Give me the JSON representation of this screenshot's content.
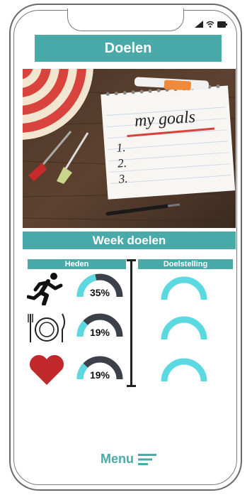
{
  "header": {
    "title": "Doelen"
  },
  "hero_image": {
    "description_icon": "goals-notebook-illustration",
    "notebook_text": "my goals",
    "list_numbers": [
      "1.",
      "2.",
      "3."
    ]
  },
  "section": {
    "title": "Week doelen"
  },
  "columns": {
    "current": "Heden",
    "target": "Doelstelling"
  },
  "rows": [
    {
      "icon": "running-icon",
      "value": "35%",
      "fraction": 0.35
    },
    {
      "icon": "plate-icon",
      "value": "19%",
      "fraction": 0.19
    },
    {
      "icon": "heart-icon",
      "value": "19%",
      "fraction": 0.19
    }
  ],
  "menu": {
    "label": "Menu"
  },
  "colors": {
    "accent": "#4aa9a9",
    "gauge_fill": "#5bd8e0",
    "gauge_track": "#3c4048",
    "heart": "#c0282c"
  }
}
